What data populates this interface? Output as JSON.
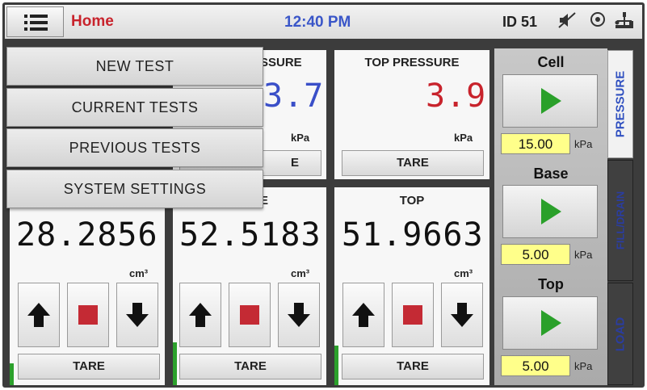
{
  "header": {
    "home_label": "Home",
    "time": "12:40 PM",
    "device_id": "ID 51"
  },
  "menu": {
    "items": [
      {
        "label": "NEW TEST"
      },
      {
        "label": "CURRENT TESTS"
      },
      {
        "label": "PREVIOUS TESTS"
      },
      {
        "label": "SYSTEM SETTINGS"
      }
    ]
  },
  "pressure_panels": [
    {
      "title": "SSURE",
      "value": "3.7",
      "unit": "kPa",
      "tare": "E",
      "color": "#3a4fc8"
    },
    {
      "title": "TOP PRESSURE",
      "value": "3.9",
      "unit": "kPa",
      "tare": "TARE",
      "color": "#c8232c"
    }
  ],
  "volume_panels": [
    {
      "title": "",
      "value": "28.2856",
      "unit": "cm³",
      "tare": "TARE"
    },
    {
      "title": "E",
      "value": "52.5183",
      "unit": "cm³",
      "tare": "TARE"
    },
    {
      "title": "TOP",
      "value": "51.9663",
      "unit": "cm³",
      "tare": "TARE"
    }
  ],
  "controllers": [
    {
      "label": "Cell",
      "setpoint": "15.00",
      "unit": "kPa"
    },
    {
      "label": "Base",
      "setpoint": "5.00",
      "unit": "kPa"
    },
    {
      "label": "Top",
      "setpoint": "5.00",
      "unit": "kPa"
    }
  ],
  "side_tabs": [
    {
      "label": "PRESSURE",
      "active": true
    },
    {
      "label": "FILL/DRAIN",
      "active": false
    },
    {
      "label": "LOAD",
      "active": false
    }
  ],
  "colors": {
    "accent_red": "#c8232c",
    "accent_blue": "#3a56c8",
    "play_green": "#2aa02a",
    "setpoint_yellow": "#ffff8a"
  },
  "icons": [
    "menu-icon",
    "mute-icon",
    "network-icon",
    "usb-icon",
    "up-arrow-icon",
    "stop-icon",
    "down-arrow-icon",
    "play-icon"
  ]
}
